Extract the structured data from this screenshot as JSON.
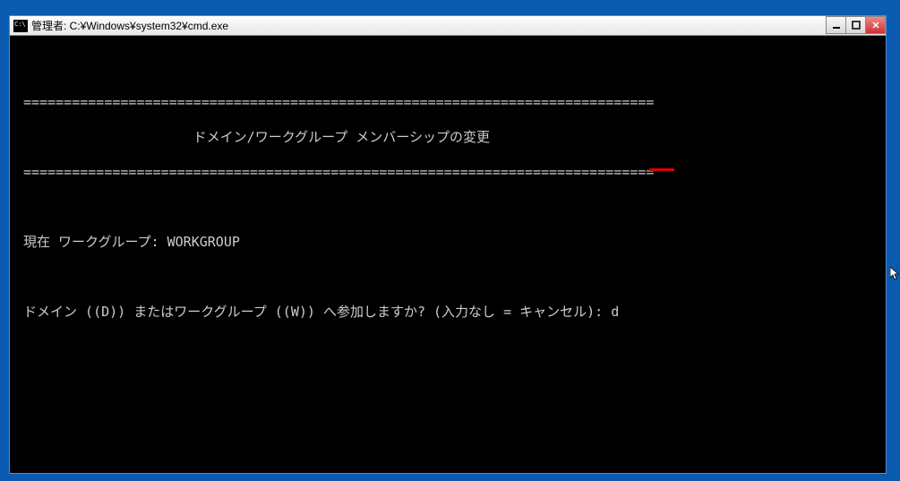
{
  "window": {
    "title": "管理者: C:¥Windows¥system32¥cmd.exe"
  },
  "terminal": {
    "ruler": " ==============================================================================",
    "header_line": "                      ドメイン/ワークグループ メンバーシップの変更",
    "current_status": " 現在 ワークグループ: WORKGROUP",
    "prompt": " ドメイン ((D)) またはワークグループ ((W)) へ参加しますか? (入力なし = キャンセル): ",
    "user_input": "d"
  },
  "controls": {
    "minimize": "minimize",
    "maximize": "maximize",
    "close": "close"
  }
}
